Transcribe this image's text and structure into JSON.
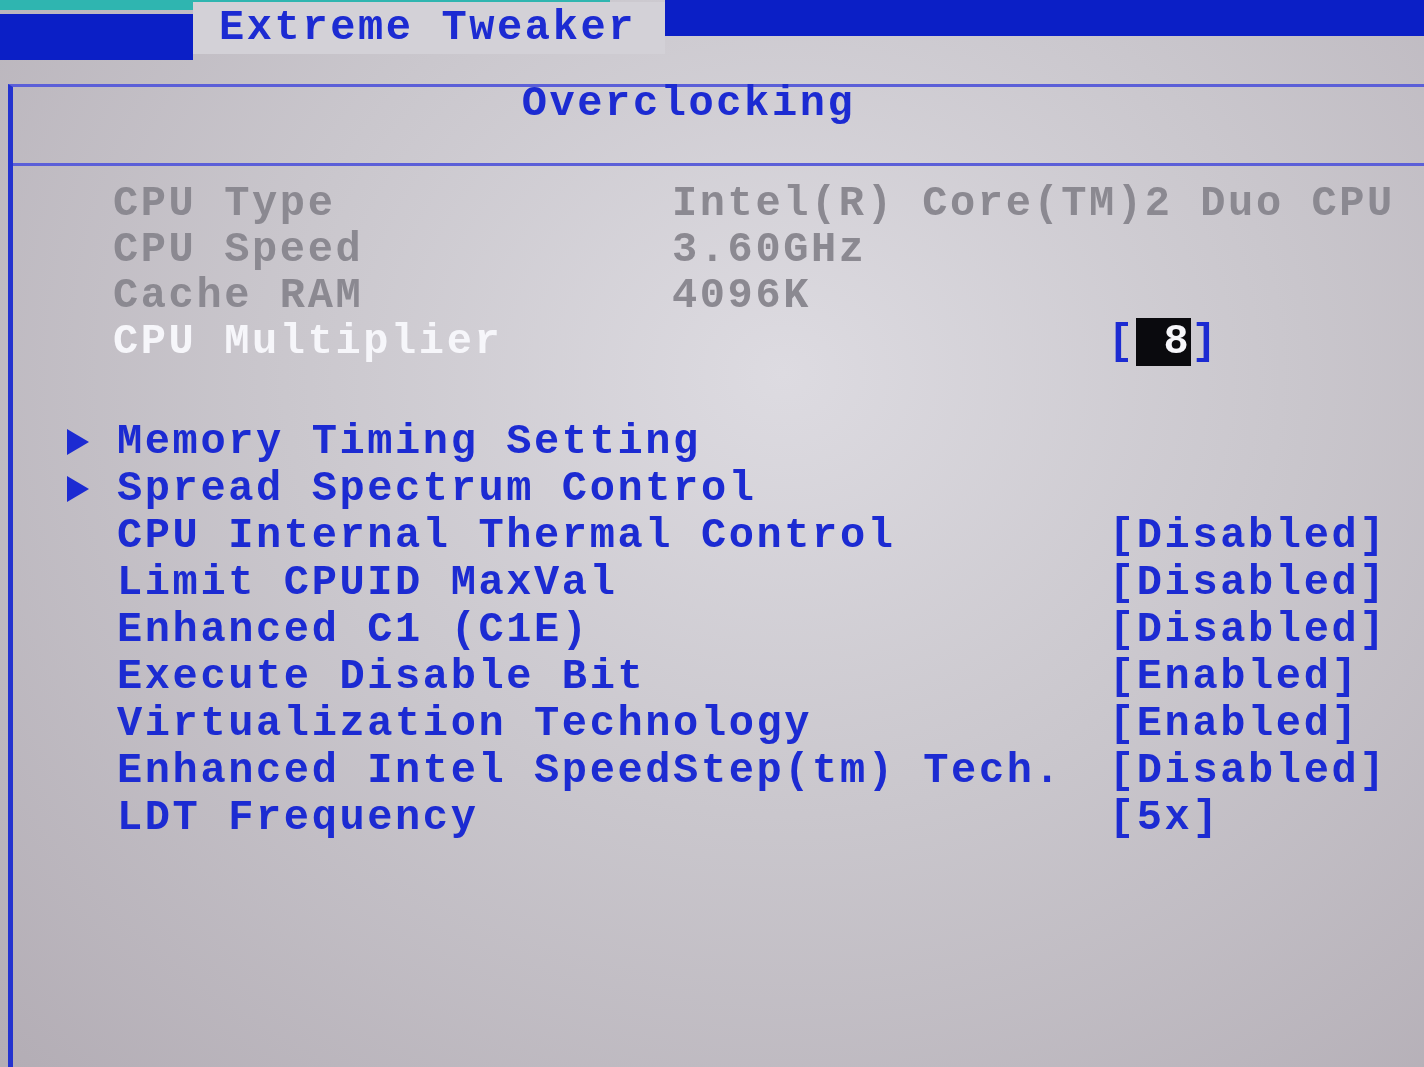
{
  "tabs": [
    {
      "label": "Extreme Tweaker",
      "selected": true
    }
  ],
  "section": {
    "title": "Overclocking"
  },
  "info_rows": [
    {
      "kind": "info",
      "label": "CPU Type",
      "value": "Intel(R) Core(TM)2 Duo CPU",
      "selected": false
    },
    {
      "kind": "info",
      "label": "CPU Speed",
      "value": "3.60GHz",
      "selected": false
    },
    {
      "kind": "info",
      "label": "Cache RAM",
      "value": "4096K",
      "selected": false
    },
    {
      "kind": "setting",
      "label": "CPU Multiplier",
      "value": "[ 8]",
      "selected": true
    }
  ],
  "menu_items": [
    {
      "kind": "submenu",
      "label": "Memory Timing Setting",
      "selected": false
    },
    {
      "kind": "submenu",
      "label": "Spread Spectrum Control",
      "selected": false
    },
    {
      "kind": "option",
      "label": "CPU Internal Thermal Control",
      "value": "[Disabled]",
      "selected": false
    },
    {
      "kind": "option",
      "label": "Limit CPUID MaxVal",
      "value": "[Disabled]",
      "selected": false
    },
    {
      "kind": "option",
      "label": "Enhanced C1 (C1E)",
      "value": "[Disabled]",
      "selected": false
    },
    {
      "kind": "option",
      "label": "Execute Disable Bit",
      "value": "[Enabled]",
      "selected": false
    },
    {
      "kind": "option",
      "label": "Virtualization Technology",
      "value": "[Enabled]",
      "selected": false
    },
    {
      "kind": "option",
      "label": "Enhanced Intel SpeedStep(tm) Tech.",
      "value": "[Disabled]",
      "selected": false
    },
    {
      "kind": "option",
      "label": "LDT Frequency",
      "value": "[5x]",
      "selected": false
    }
  ]
}
